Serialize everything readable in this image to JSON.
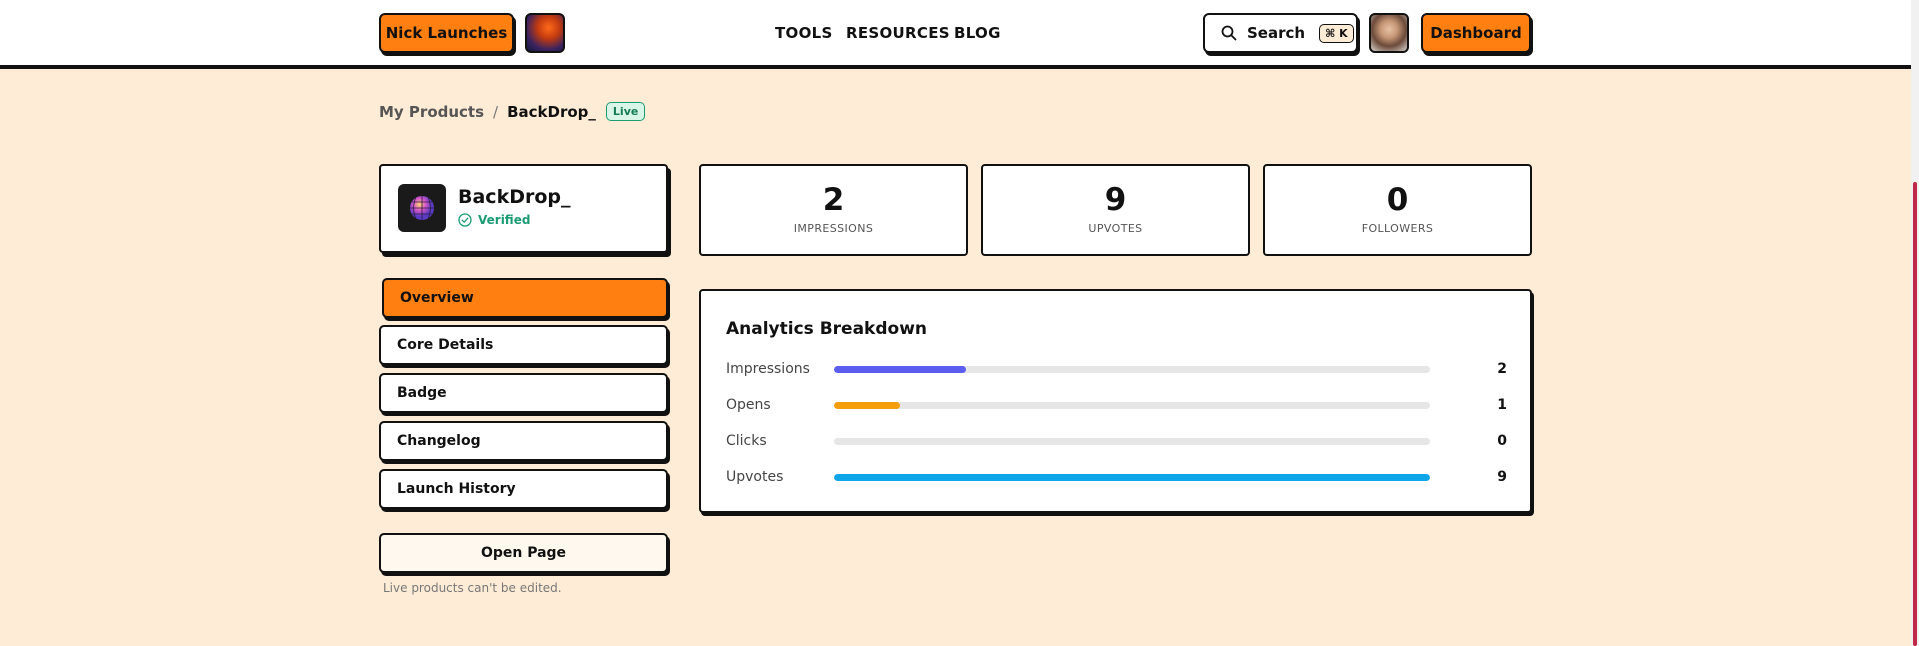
{
  "header": {
    "brand_label": "Nick Launches",
    "nav": [
      "TOOLS",
      "RESOURCES",
      "BLOG"
    ],
    "search_label": "Search",
    "search_shortcut": "⌘ K",
    "dashboard_label": "Dashboard"
  },
  "breadcrumb": {
    "parent": "My Products",
    "separator": "/",
    "current": "BackDrop_",
    "status_badge": "Live"
  },
  "product": {
    "name": "BackDrop_",
    "verified_label": "Verified"
  },
  "stats": [
    {
      "value": "2",
      "label": "IMPRESSIONS"
    },
    {
      "value": "9",
      "label": "UPVOTES"
    },
    {
      "value": "0",
      "label": "FOLLOWERS"
    }
  ],
  "tabs": [
    {
      "label": "Overview",
      "active": true
    },
    {
      "label": "Core Details",
      "active": false
    },
    {
      "label": "Badge",
      "active": false
    },
    {
      "label": "Changelog",
      "active": false
    },
    {
      "label": "Launch History",
      "active": false
    }
  ],
  "open_page_label": "Open Page",
  "edit_note": "Live products can't be edited.",
  "analytics": {
    "title": "Analytics Breakdown",
    "rows": [
      {
        "label": "Impressions",
        "value": "2",
        "fill_fraction": 0.222,
        "color": "#5b5cf0"
      },
      {
        "label": "Opens",
        "value": "1",
        "fill_fraction": 0.111,
        "color": "#f59e0b"
      },
      {
        "label": "Clicks",
        "value": "0",
        "fill_fraction": 0,
        "color": "#cccccc"
      },
      {
        "label": "Upvotes",
        "value": "9",
        "fill_fraction": 1.0,
        "color": "#0ea5e9"
      }
    ]
  },
  "colors": {
    "accent": "#ff7f11",
    "page_background": "#ffecd6",
    "verified_green": "#1a9c72"
  },
  "icons": {
    "search": "search-icon",
    "verified": "check-circle-icon"
  }
}
